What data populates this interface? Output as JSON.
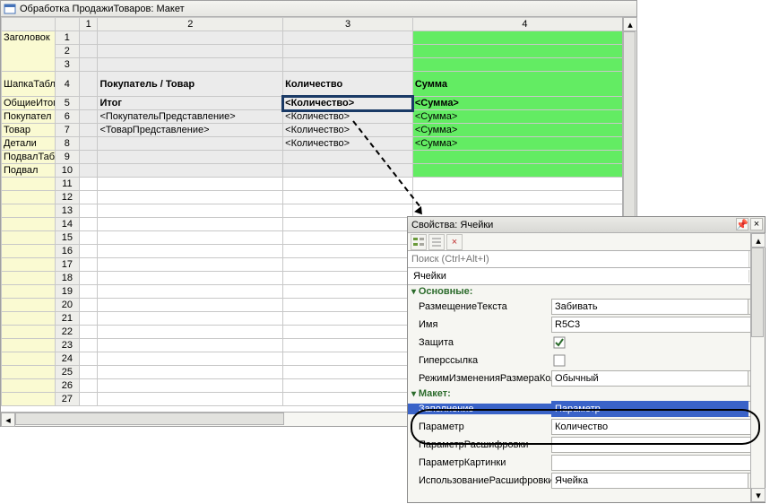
{
  "editor": {
    "title": "Обработка ПродажиТоваров: Макет",
    "cols": [
      "1",
      "2",
      "3",
      "4"
    ],
    "sections": [
      "Заголовок",
      "ШапкаТабл",
      "ОбщиеИтог",
      "Покупател",
      "Товар",
      "Детали",
      "ПодвалТабл",
      "Подвал"
    ],
    "nums": [
      "1",
      "2",
      "3",
      "4",
      "5",
      "6",
      "7",
      "8",
      "9",
      "10",
      "11",
      "12",
      "13",
      "14",
      "15",
      "16",
      "17",
      "18",
      "19",
      "20",
      "21",
      "22",
      "23",
      "24",
      "25",
      "26",
      "27"
    ],
    "r4": {
      "c2": "Покупатель /\nТовар",
      "c3": "Количество",
      "c4": "Сумма"
    },
    "r5": {
      "c2": "Итог",
      "c3": "<Количество>",
      "c4": "<Сумма>"
    },
    "r6": {
      "c2": "<ПокупательПредставление>",
      "c3": "<Количество>",
      "c4": "<Сумма>"
    },
    "r7": {
      "c2": "<ТоварПредставление>",
      "c3": "<Количество>",
      "c4": "<Сумма>"
    },
    "r8": {
      "c3": "<Количество>",
      "c4": "<Сумма>"
    }
  },
  "props": {
    "title": "Свойства: Ячейки",
    "search_placeholder": "Поиск (Ctrl+Alt+I)",
    "object": "Ячейки",
    "groups": [
      "Основные:",
      "Макет:"
    ],
    "rows": [
      {
        "label": "РазмещениеТекста",
        "value": "Забивать"
      },
      {
        "label": "Имя",
        "value": "R5C3"
      },
      {
        "label": "Защита",
        "value": "true"
      },
      {
        "label": "Гиперссылка",
        "value": "false"
      },
      {
        "label": "РежимИзмененияРазмераКолонки",
        "value": "Обычный"
      },
      {
        "label": "Заполнение",
        "value": "Параметр"
      },
      {
        "label": "Параметр",
        "value": "Количество"
      },
      {
        "label": "ПараметрРасшифровки",
        "value": ""
      },
      {
        "label": "ПараметрКартинки",
        "value": ""
      },
      {
        "label": "ИспользованиеРасшифровки",
        "value": "Ячейка"
      }
    ]
  }
}
